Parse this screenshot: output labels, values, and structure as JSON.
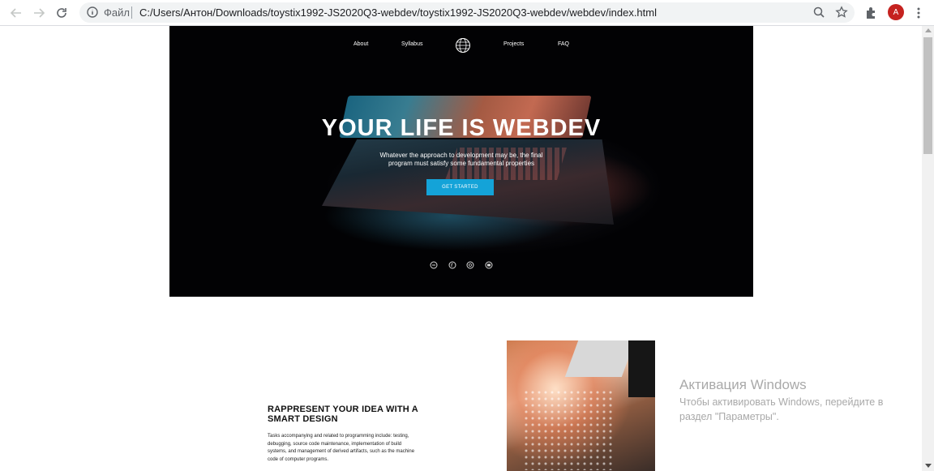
{
  "browser": {
    "back_icon": "arrow-left-icon",
    "forward_icon": "arrow-right-icon",
    "reload_icon": "reload-icon",
    "scheme_label": "Файл",
    "url": "C:/Users/Антон/Downloads/toystix1992-JS2020Q3-webdev/toystix1992-JS2020Q3-webdev/webdev/index.html",
    "zoom_icon": "magnifier-icon",
    "bookmark_icon": "star-icon",
    "extensions_icon": "puzzle-icon",
    "profile_initial": "A",
    "profile_color": "#c5221f",
    "menu_icon": "kebab-menu-icon"
  },
  "hero": {
    "nav": [
      "About",
      "Syllabus",
      "Projects",
      "FAQ"
    ],
    "logo_icon": "globe-logo-icon",
    "title": "YOUR LIFE IS WEBDEV",
    "subtitle": "Whatever the approach to development may be, the final program must satisfy some fundamental properties",
    "cta_label": "GET STARTED",
    "cta_color": "#14a3d8",
    "social_icons": [
      "social-icon-1",
      "social-icon-2",
      "social-icon-3",
      "social-icon-4"
    ]
  },
  "feature": {
    "title": "RAPPRESENT YOUR IDEA WITH A SMART DESIGN",
    "text": "Tasks accompanying and related to programming include: testing, debugging, source code maintenance, implementation of build systems, and management of derived artifacts, such as the machine code of computer programs."
  },
  "watermark": {
    "title": "Активация Windows",
    "text": "Чтобы активировать Windows, перейдите в раздел \"Параметры\"."
  }
}
